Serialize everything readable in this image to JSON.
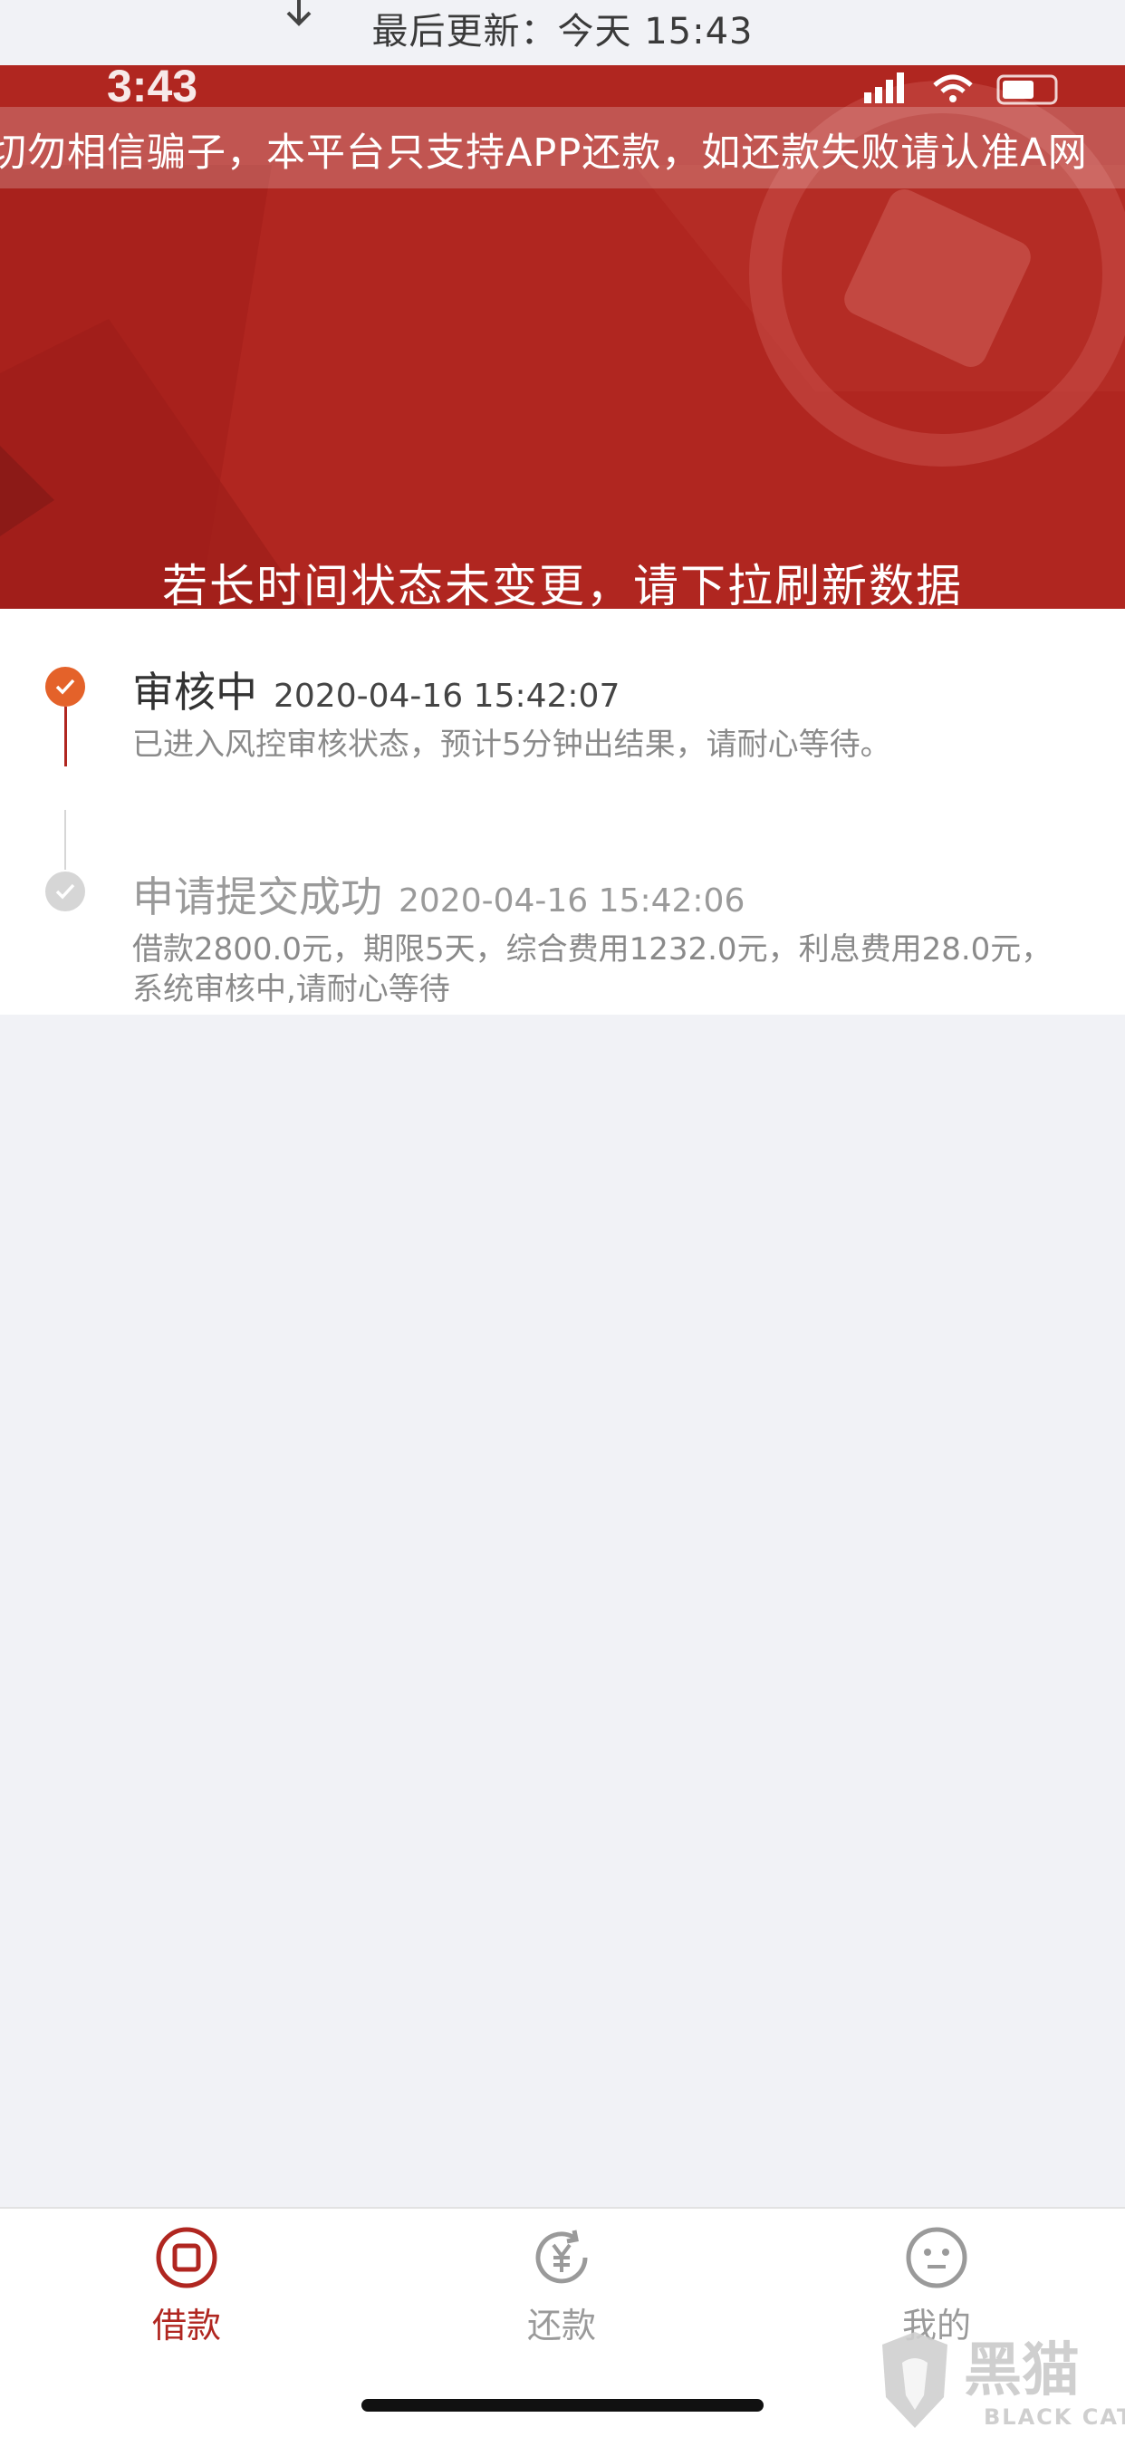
{
  "refresh": {
    "text": "最后更新：今天 15:43"
  },
  "status_bar": {
    "time": "3:43"
  },
  "banner": {
    "marquee": "切勿相信骗子，本平台只支持APP还款，如还款失败请认准A网",
    "hint": "若长时间状态未变更，请下拉刷新数据"
  },
  "timeline": {
    "steps": [
      {
        "title": "审核中",
        "time": "2020-04-16 15:42:07",
        "desc": "已进入风控审核状态，预计5分钟出结果，请耐心等待。",
        "status": "active"
      },
      {
        "title": "申请提交成功",
        "time": "2020-04-16 15:42:06",
        "desc": "借款2800.0元，期限5天，综合费用1232.0元，利息费用28.0元，系统审核中,请耐心等待",
        "status": "done"
      }
    ]
  },
  "tabbar": {
    "tabs": [
      {
        "label": "借款",
        "icon": "loan-icon",
        "active": true
      },
      {
        "label": "还款",
        "icon": "repay-yen-icon",
        "active": false
      },
      {
        "label": "我的",
        "icon": "profile-face-icon",
        "active": false
      }
    ]
  },
  "colors": {
    "brand_red": "#b02620",
    "active_orange": "#e4622a",
    "inactive_gray": "#9a9a9a"
  },
  "watermark": {
    "text": "黑猫",
    "subtext": "BLACK CAT"
  }
}
